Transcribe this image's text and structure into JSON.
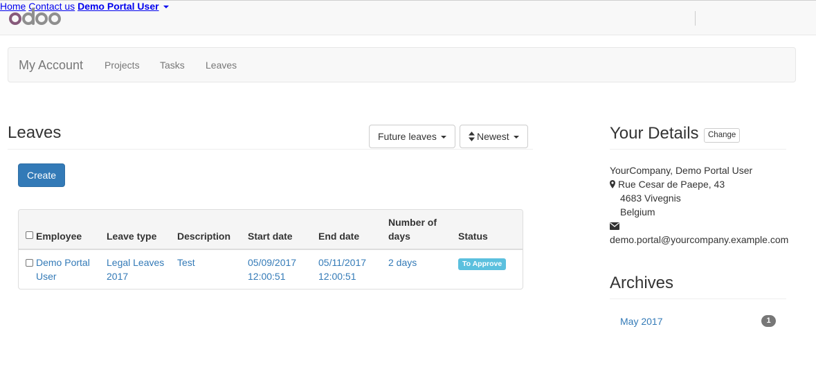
{
  "brand": {
    "logo_text": "odoo",
    "colors": {
      "o1": "#875a7b",
      "rest": "#8f8f8f"
    }
  },
  "topnav": {
    "home": "Home",
    "contact": "Contact us",
    "user": "Demo Portal User"
  },
  "subnav": {
    "brand": "My Account",
    "items": [
      "Projects",
      "Tasks",
      "Leaves"
    ]
  },
  "page": {
    "title": "Leaves",
    "filter_label": "Future leaves",
    "sort_label": "Newest",
    "create_label": "Create"
  },
  "table": {
    "headers": {
      "employee": "Employee",
      "leave_type": "Leave type",
      "description": "Description",
      "start_date": "Start date",
      "end_date": "End date",
      "days_line1": "Number of",
      "days_line2": "days",
      "status": "Status"
    },
    "rows": [
      {
        "employee_line1": "Demo Portal",
        "employee_line2": "User",
        "leave_type_line1": "Legal Leaves",
        "leave_type_line2": "2017",
        "description": "Test",
        "start_date": "05/09/2017",
        "start_time": "12:00:51",
        "end_date": "05/11/2017",
        "end_time": "12:00:51",
        "days": "2 days",
        "status": "To Approve"
      }
    ]
  },
  "details": {
    "title": "Your Details",
    "change_label": "Change",
    "company_line": "YourCompany, Demo Portal User",
    "street": "Rue Cesar de Paepe, 43",
    "city": "4683 Vivegnis",
    "country": "Belgium",
    "email": "demo.portal@yourcompany.example.com"
  },
  "archives": {
    "title": "Archives",
    "items": [
      {
        "label": "May 2017",
        "count": "1"
      }
    ]
  },
  "icons": {
    "map_marker": "map-marker-icon",
    "envelope": "envelope-icon",
    "sort": "sort-icon"
  },
  "colors": {
    "link": "#337ab7",
    "primary": "#337ab7",
    "status_info": "#5bc0de",
    "badge": "#777777"
  }
}
